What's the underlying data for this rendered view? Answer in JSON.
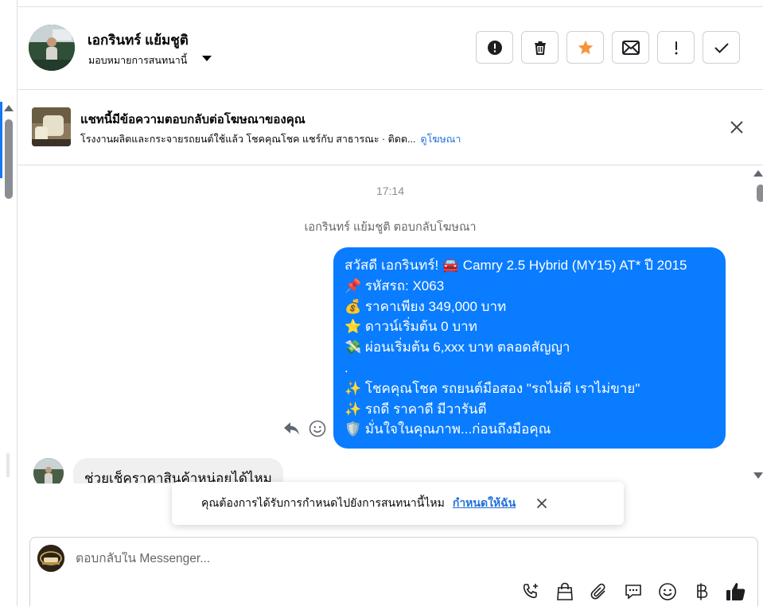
{
  "header": {
    "contact_name": "เอกรินทร์ แย้มชูติ",
    "assign_label": "มอบหมายการสนทนานี้",
    "actions": [
      {
        "name": "spam-button",
        "icon": "alert-circle-icon"
      },
      {
        "name": "delete-button",
        "icon": "trash-icon"
      },
      {
        "name": "star-button",
        "icon": "star-icon",
        "color": "#f7923b"
      },
      {
        "name": "mark-unread-button",
        "icon": "envelope-icon"
      },
      {
        "name": "follow-up-button",
        "icon": "exclamation-icon"
      },
      {
        "name": "mark-done-button",
        "icon": "check-icon"
      }
    ]
  },
  "ad_banner": {
    "title": "แชทนี้มีข้อความตอบกลับต่อโฆษณาของคุณ",
    "subtitle": "โรงงานผลิตและกระจายรถยนต์ใช้แล้ว โชคคุณโชค แชร์กับ สาธารณะ · ติดต...",
    "link": "ดูโฆษณา"
  },
  "thread": {
    "time": "17:14",
    "system_note": "เอกรินทร์ แย้มชูติ ตอบกลับโฆษณา",
    "outgoing_lines": [
      "สวัสดี เอกรินทร์! 🚘 Camry 2.5 Hybrid (MY15) AT* ปี 2015",
      "📌 รหัสรถ: X063",
      "💰 ราคาเพียง 349,000 บาท",
      "⭐ ดาวน์เริ่มต้น 0 บาท",
      "💸 ผ่อนเริ่มต้น 6,xxx บาท ตลอดสัญญา",
      ".",
      "✨ โชคคุณโชค รถยนต์มือสอง \"รถไม่ดี เราไม่ขาย\"",
      "✨ รถดี ราคาดี มีวารันตี",
      "🛡️ มั่นใจในคุณภาพ...ก่อนถึงมือคุณ"
    ],
    "incoming_message": "ช่วยเช็คราคาสินค้าหน่อยได้ไหม",
    "bubble_color": "#0a7cff"
  },
  "toast": {
    "text": "คุณต้องการได้รับการกำหนดไปยังการสนทนานี้ไหม",
    "link": "กำหนดให้ฉัน"
  },
  "composer": {
    "placeholder": "ตอบกลับใน Messenger...",
    "tools": [
      "phone-add-icon",
      "shopping-bag-icon",
      "paperclip-icon",
      "saved-reply-icon",
      "emoji-icon",
      "baht-icon",
      "like-icon"
    ]
  }
}
